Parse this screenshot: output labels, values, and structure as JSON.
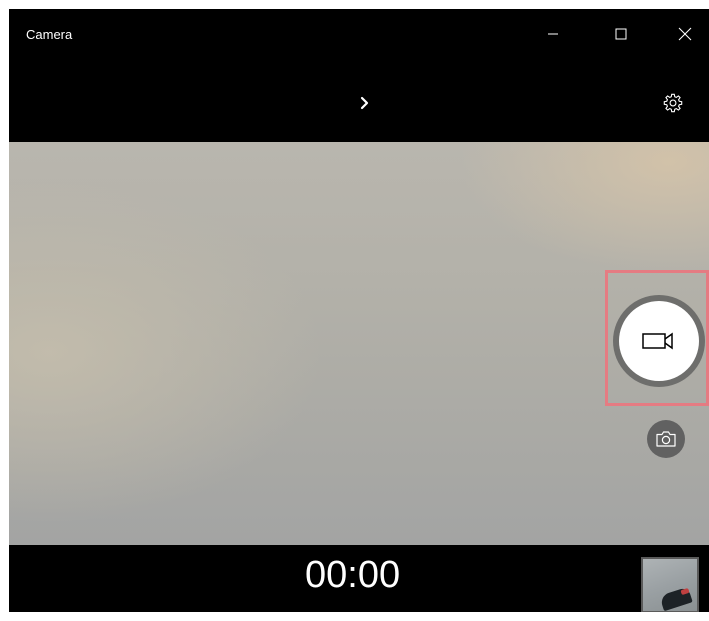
{
  "window": {
    "title": "Camera",
    "controls": {
      "minimize_icon": "minimize-icon",
      "maximize_icon": "maximize-icon",
      "close_icon": "close-icon"
    }
  },
  "toolbar": {
    "expand_icon": "chevron-right-icon",
    "settings_icon": "gear-icon"
  },
  "capture": {
    "mode": "video",
    "record_icon": "video-camera-icon",
    "photo_icon": "camera-icon",
    "highlight_color": "#e57b82"
  },
  "status": {
    "timer": "00:00"
  },
  "gallery": {
    "thumbnail_icon": "last-capture-thumbnail"
  }
}
